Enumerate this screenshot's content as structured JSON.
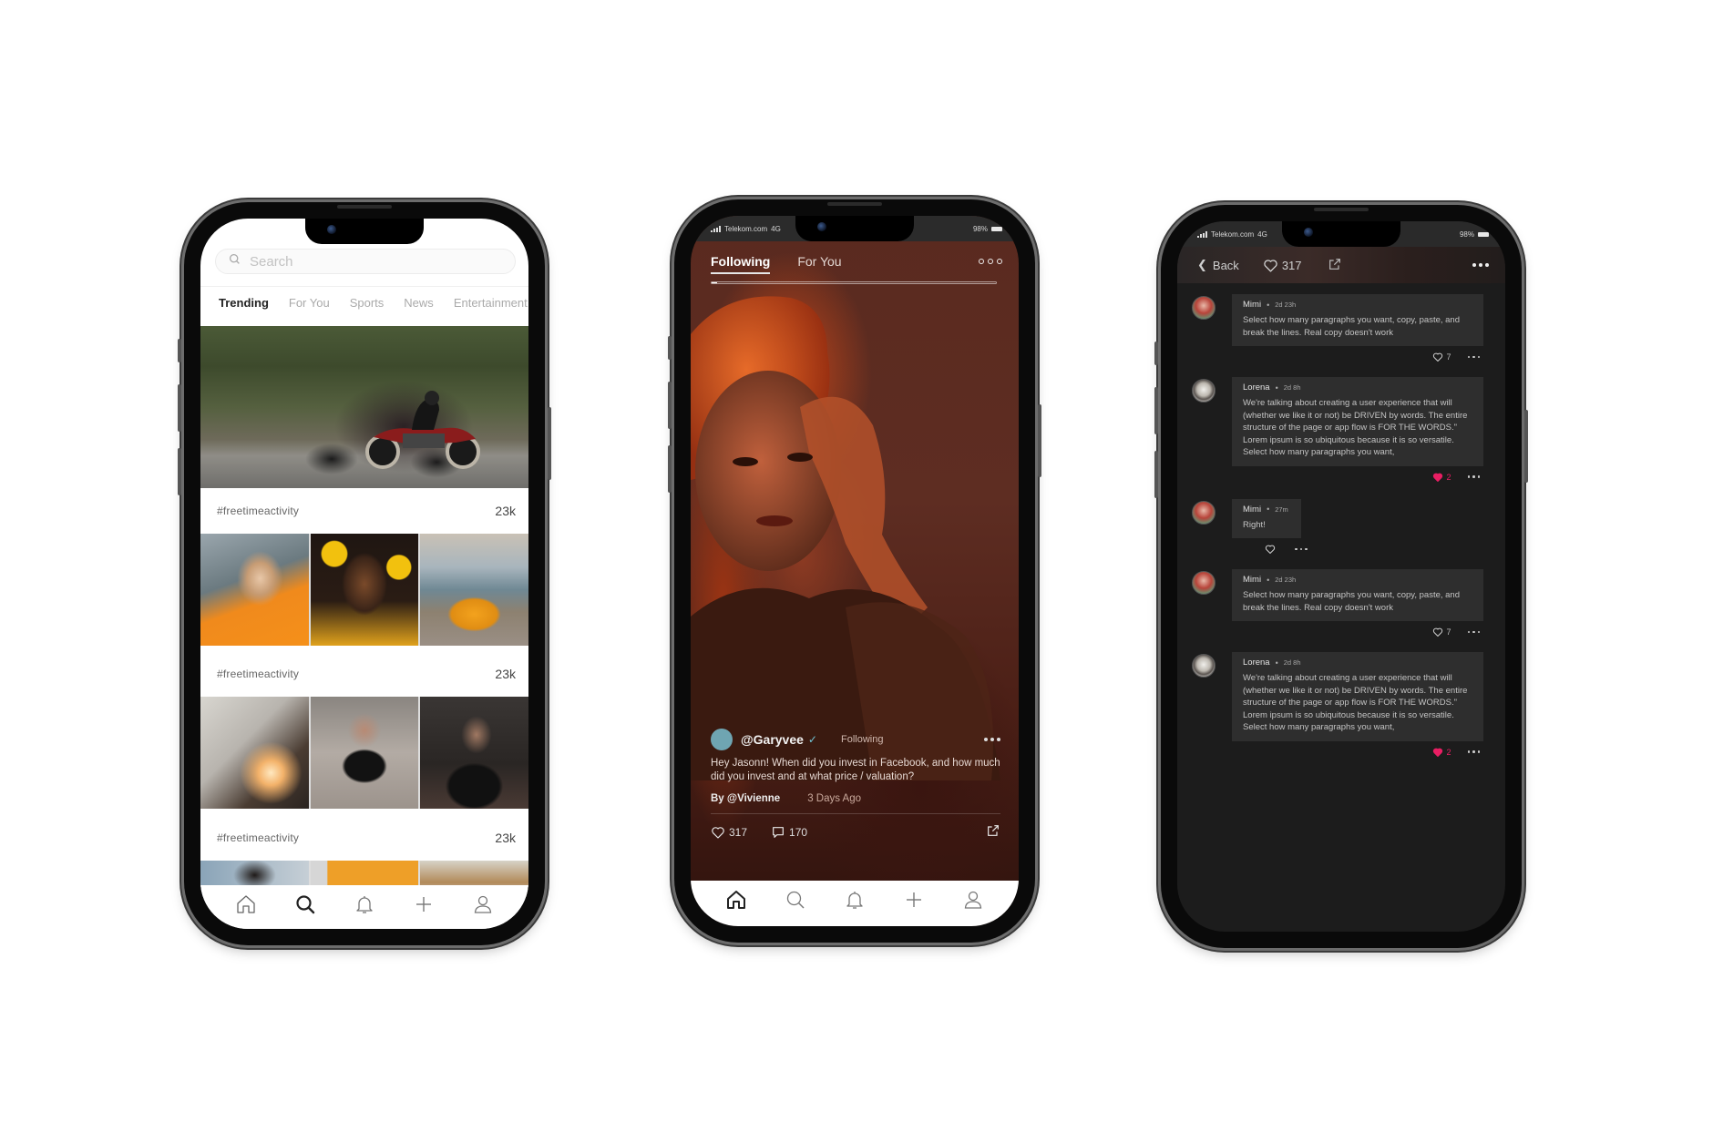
{
  "colors": {
    "accent_pink": "#e91e63",
    "dark_bg": "#1c1c1c",
    "bubble_bg": "#2e2e2e",
    "verified": "#72c4d4"
  },
  "explore_screen": {
    "search": {
      "placeholder": "Search",
      "value": ""
    },
    "tabs": [
      {
        "label": "Trending",
        "active": true
      },
      {
        "label": "For You",
        "active": false
      },
      {
        "label": "Sports",
        "active": false
      },
      {
        "label": "News",
        "active": false
      },
      {
        "label": "Entertainment",
        "active": false
      }
    ],
    "sections": [
      {
        "tag": "#freetimeactivity",
        "count": "23k"
      },
      {
        "tag": "#freetimeactivity",
        "count": "23k"
      },
      {
        "tag": "#freetimeactivity",
        "count": "23k"
      }
    ],
    "nav": [
      "home-icon",
      "search-icon",
      "bell-icon",
      "plus-icon",
      "profile-icon"
    ],
    "nav_active": "search-icon"
  },
  "feed_screen": {
    "status": {
      "carrier": "Telekom.com",
      "network": "4G",
      "battery": "98%"
    },
    "tabs": [
      {
        "label": "Following",
        "active": true
      },
      {
        "label": "For You",
        "active": false
      }
    ],
    "progress": 0.02,
    "post": {
      "handle": "@Garyvee",
      "verified": true,
      "follow_state": "Following",
      "caption": "Hey Jasonn! When did you invest in Facebook, and how much did you invest and at what price / valuation?",
      "by": "By @Vivienne",
      "time": "3 Days Ago",
      "likes": "317",
      "comments": "170"
    },
    "nav": [
      "home-icon",
      "search-icon",
      "bell-icon",
      "plus-icon",
      "profile-icon"
    ],
    "nav_active": "home-icon"
  },
  "comments_screen": {
    "status": {
      "carrier": "Telekom.com",
      "network": "4G",
      "battery": "98%"
    },
    "header": {
      "back_label": "Back",
      "likes": "317"
    },
    "comments": [
      {
        "name": "Mimi",
        "time": "2d 23h",
        "avatar": "mimi",
        "text": "Select how many paragraphs you want, copy, paste, and break the lines. Real copy doesn't work",
        "likes": "7",
        "liked": false,
        "narrow": false
      },
      {
        "name": "Lorena",
        "time": "2d 8h",
        "avatar": "lorena",
        "text": "We're talking about creating a user experience that will (whether we like it or not) be DRIVEN by words. The entire structure of the page or app flow is FOR THE WORDS.\"\nLorem ipsum is so ubiquitous because it is so versatile. Select how many paragraphs you want,",
        "likes": "2",
        "liked": true,
        "narrow": false
      },
      {
        "name": "Mimi",
        "time": "27m",
        "avatar": "mimi",
        "text": "Right!",
        "likes": "",
        "liked": false,
        "narrow": true
      },
      {
        "name": "Mimi",
        "time": "2d 23h",
        "avatar": "mimi",
        "text": "Select how many paragraphs you want, copy, paste, and break the lines. Real copy doesn't work",
        "likes": "7",
        "liked": false,
        "narrow": false
      },
      {
        "name": "Lorena",
        "time": "2d 8h",
        "avatar": "lorena",
        "text": "We're talking about creating a user experience that will (whether we like it or not) be DRIVEN by words. The entire structure of the page or app flow is FOR THE WORDS.\"\nLorem ipsum is so ubiquitous because it is so versatile. Select how many paragraphs you want,",
        "likes": "2",
        "liked": true,
        "narrow": false
      }
    ]
  }
}
